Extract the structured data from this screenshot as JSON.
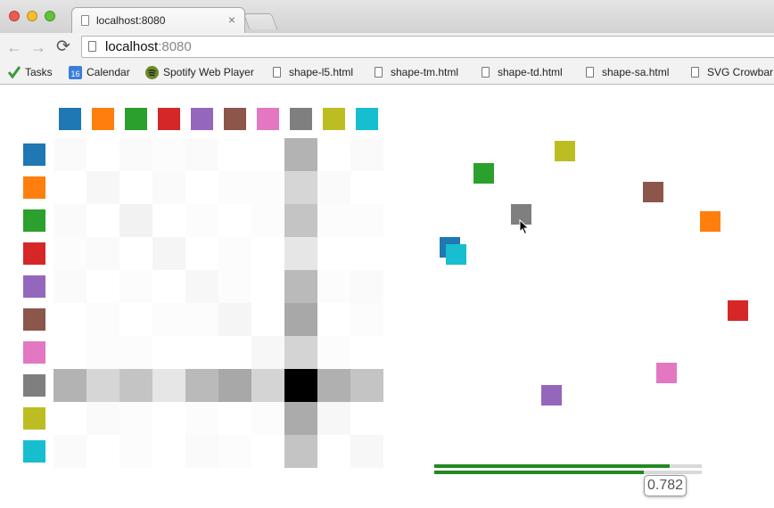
{
  "browser": {
    "tab_title": "localhost:8080",
    "tab_close": "×",
    "url_host": "localhost",
    "url_port": ":8080",
    "back_icon": "←",
    "forward_icon": "→",
    "reload_icon": "⟳"
  },
  "bookmarks": [
    {
      "label": "Tasks",
      "icon": "checkmark-icon"
    },
    {
      "label": "Calendar",
      "icon": "calendar-icon"
    },
    {
      "label": "Spotify Web Player",
      "icon": "spotify-icon"
    },
    {
      "label": "shape-l5.html",
      "icon": "page-icon"
    },
    {
      "label": "shape-tm.html",
      "icon": "page-icon"
    },
    {
      "label": "shape-td.html",
      "icon": "page-icon"
    },
    {
      "label": "shape-sa.html",
      "icon": "page-icon"
    },
    {
      "label": "SVG Crowbar",
      "icon": "page-icon"
    }
  ],
  "palette": [
    "#1f77b4",
    "#ff7f0e",
    "#2ca02c",
    "#d62728",
    "#9467bd",
    "#8c564b",
    "#e377c2",
    "#7f7f7f",
    "#bcbd22",
    "#17becf"
  ],
  "chart_data": [
    {
      "type": "heatmap",
      "rows": [
        "#1f77b4",
        "#ff7f0e",
        "#2ca02c",
        "#d62728",
        "#9467bd",
        "#8c564b",
        "#e377c2",
        "#7f7f7f",
        "#bcbd22",
        "#17becf"
      ],
      "cols": [
        "#1f77b4",
        "#ff7f0e",
        "#2ca02c",
        "#d62728",
        "#9467bd",
        "#8c564b",
        "#e377c2",
        "#7f7f7f",
        "#bcbd22",
        "#17becf"
      ],
      "values": [
        [
          0.02,
          0.0,
          0.02,
          0.01,
          0.02,
          0.0,
          0.0,
          0.3,
          0.0,
          0.02
        ],
        [
          0.0,
          0.03,
          0.0,
          0.02,
          0.0,
          0.01,
          0.01,
          0.16,
          0.02,
          0.0
        ],
        [
          0.02,
          0.0,
          0.05,
          0.0,
          0.01,
          0.0,
          0.01,
          0.23,
          0.01,
          0.01
        ],
        [
          0.01,
          0.02,
          0.0,
          0.04,
          0.0,
          0.01,
          0.0,
          0.1,
          0.0,
          0.0
        ],
        [
          0.02,
          0.0,
          0.01,
          0.0,
          0.03,
          0.01,
          0.0,
          0.27,
          0.01,
          0.02
        ],
        [
          0.0,
          0.01,
          0.0,
          0.01,
          0.01,
          0.04,
          0.0,
          0.34,
          0.0,
          0.01
        ],
        [
          0.0,
          0.01,
          0.01,
          0.0,
          0.0,
          0.0,
          0.03,
          0.17,
          0.01,
          0.0
        ],
        [
          0.3,
          0.16,
          0.23,
          0.1,
          0.27,
          0.34,
          0.17,
          1.0,
          0.31,
          0.23
        ],
        [
          0.0,
          0.02,
          0.01,
          0.0,
          0.01,
          0.0,
          0.01,
          0.33,
          0.03,
          0.0
        ],
        [
          0.02,
          0.0,
          0.01,
          0.0,
          0.02,
          0.01,
          0.0,
          0.23,
          0.0,
          0.03
        ]
      ]
    },
    {
      "type": "scatter",
      "points": [
        {
          "color": "#1f77b4",
          "x": 0.06,
          "y": 0.34
        },
        {
          "color": "#17becf",
          "x": 0.08,
          "y": 0.36
        },
        {
          "color": "#2ca02c",
          "x": 0.16,
          "y": 0.14
        },
        {
          "color": "#bcbd22",
          "x": 0.4,
          "y": 0.08
        },
        {
          "color": "#7f7f7f",
          "x": 0.27,
          "y": 0.25
        },
        {
          "color": "#9467bd",
          "x": 0.36,
          "y": 0.74
        },
        {
          "color": "#8c564b",
          "x": 0.66,
          "y": 0.19
        },
        {
          "color": "#ff7f0e",
          "x": 0.83,
          "y": 0.27
        },
        {
          "color": "#d62728",
          "x": 0.91,
          "y": 0.51
        },
        {
          "color": "#e377c2",
          "x": 0.7,
          "y": 0.68
        }
      ]
    }
  ],
  "slider": {
    "value": 0.782,
    "value_label": "0.782"
  }
}
